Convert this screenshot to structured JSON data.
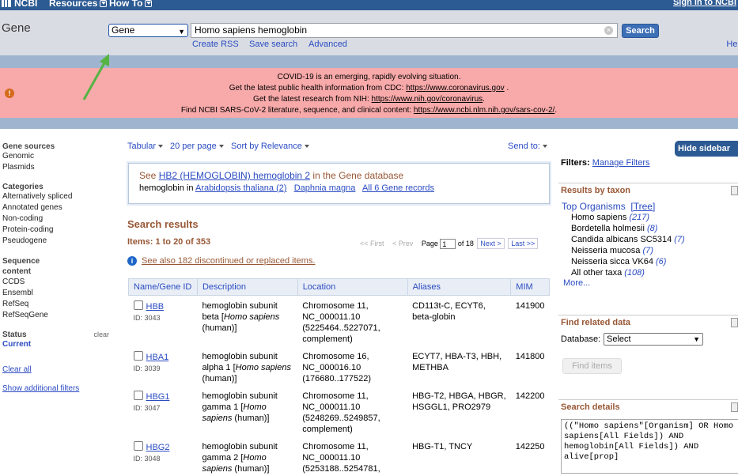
{
  "topbar": {
    "logo": "NCBI",
    "resources": "Resources",
    "howto": "How To",
    "signin": "Sign in to NCBI"
  },
  "search": {
    "db_label": "Gene",
    "db_selected": "Gene",
    "term": "Homo sapiens hemoglobin",
    "button": "Search",
    "links": [
      "Create RSS",
      "Save search",
      "Advanced"
    ],
    "help": "Help"
  },
  "alert": {
    "lines": [
      "COVID-19 is an emerging, rapidly evolving situation.",
      "Get the latest public health information from CDC: ",
      "Get the latest research from NIH: ",
      "Find NCBI SARS-CoV-2 literature, sequence, and clinical content: "
    ],
    "links": [
      "https://www.coronavirus.gov",
      "https://www.nih.gov/coronavirus",
      "https://www.ncbi.nlm.nih.gov/sars-cov-2/"
    ]
  },
  "leftnav": {
    "sections": [
      {
        "title": "Gene sources",
        "items": [
          "Genomic",
          "Plasmids"
        ]
      },
      {
        "title": "Categories",
        "items": [
          "Alternatively spliced",
          "Annotated genes",
          "Non-coding",
          "Protein-coding",
          "Pseudogene"
        ]
      },
      {
        "title": "Sequence content",
        "items": [
          "CCDS",
          "Ensembl",
          "RefSeq",
          "RefSeqGene"
        ]
      }
    ],
    "status": {
      "title": "Status",
      "clear": "clear",
      "value": "Current"
    },
    "clear_all": "Clear all",
    "show_filters": "Show additional filters"
  },
  "toolbar": {
    "format": "Tabular",
    "per_page": "20 per page",
    "sort": "Sort by Relevance",
    "send_to": "Send to:"
  },
  "seebox": {
    "see": "See ",
    "hb2": "HB2 (HEMOGLOBIN) hemoglobin 2",
    "in_db": " in the Gene database",
    "l2_prefix": "hemoglobin in ",
    "l2_links": [
      "Arabidopsis thaliana (2)",
      "Daphnia magna",
      "All 6 Gene records"
    ]
  },
  "results": {
    "title": "Search results",
    "items": "Items: 1 to 20 of 353",
    "pager": {
      "first": "<< First",
      "prev": "< Prev",
      "page_label": "Page",
      "page": "1",
      "of": "of 18",
      "next": "Next >",
      "last": "Last >>"
    },
    "see_also": "See also 182 discontinued or replaced items.",
    "headers": [
      "Name/Gene ID",
      "Description",
      "Location",
      "Aliases",
      "MIM"
    ],
    "rows": [
      {
        "name": "HBB",
        "id": "ID: 3043",
        "desc_a": "hemoglobin subunit beta [",
        "desc_i": "Homo sapiens",
        "desc_b": " (human)]",
        "loc": "Chromosome 11, NC_000011.10 (5225464..5227071, complement)",
        "aliases": "CD113t-C, ECYT6, beta-globin",
        "mim": "141900"
      },
      {
        "name": "HBA1",
        "id": "ID: 3039",
        "desc_a": "hemoglobin subunit alpha 1 [",
        "desc_i": "Homo sapiens",
        "desc_b": " (human)]",
        "loc": "Chromosome 16, NC_000016.10 (176680..177522)",
        "aliases": "ECYT7, HBA-T3, HBH, METHBA",
        "mim": "141800"
      },
      {
        "name": "HBG1",
        "id": "ID: 3047",
        "desc_a": "hemoglobin subunit gamma 1 [",
        "desc_i": "Homo sapiens",
        "desc_b": " (human)]",
        "loc": "Chromosome 11, NC_000011.10 (5248269..5249857, complement)",
        "aliases": "HBG-T2, HBGA, HBGR, HSGGL1, PRO2979",
        "mim": "142200"
      },
      {
        "name": "HBG2",
        "id": "ID: 3048",
        "desc_a": "hemoglobin subunit gamma 2 [",
        "desc_i": "Homo sapiens",
        "desc_b": " (human)]",
        "loc": "Chromosome 11, NC_000011.10 (5253188..5254781,",
        "aliases": "HBG-T1, TNCY",
        "mim": "142250"
      }
    ]
  },
  "right": {
    "hide_sidebar": "Hide sidebar >>",
    "filters_label": "Filters:",
    "manage_filters": "Manage Filters",
    "taxon_title": "Results by taxon",
    "top_orgs": "Top Organisms",
    "tree": "[Tree]",
    "taxa": [
      {
        "name": "Homo sapiens",
        "count": "(217)"
      },
      {
        "name": "Bordetella holmesii",
        "count": "(8)"
      },
      {
        "name": "Candida albicans SC5314",
        "count": "(7)"
      },
      {
        "name": "Neisseria mucosa",
        "count": "(7)"
      },
      {
        "name": "Neisseria sicca VK64",
        "count": "(6)"
      },
      {
        "name": "All other taxa",
        "count": "(108)"
      }
    ],
    "more": "More...",
    "related_title": "Find related data",
    "database_label": "Database:",
    "database_value": "Select",
    "find_items": "Find items",
    "details_title": "Search details",
    "details_text": "((\"Homo sapiens\"[Organism] OR Homo sapiens[All Fields]) AND hemoglobin[All Fields]) AND alive[prop]"
  },
  "colors": {
    "header_blue": "#2c5a92",
    "alert_pink": "#f8a9a9",
    "title_brown": "#985735",
    "link_blue": "#2a4bc2",
    "arrow_green": "#55b442"
  }
}
